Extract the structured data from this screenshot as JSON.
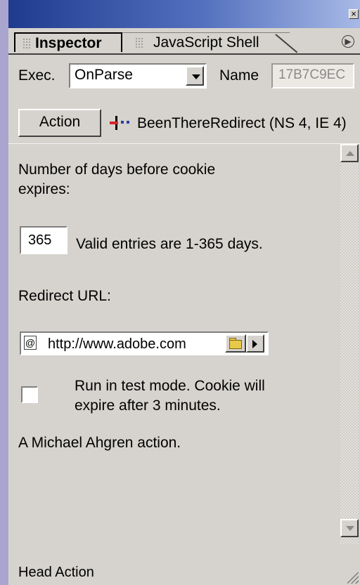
{
  "tabs": {
    "inspector": "Inspector",
    "javascript_shell": "JavaScript Shell"
  },
  "top_row": {
    "exec_label": "Exec.",
    "exec_value": "OnParse",
    "name_label": "Name",
    "name_value": "17B7C9EC"
  },
  "action_row": {
    "button_label": "Action",
    "behavior_name": "BeenThereRedirect (NS 4, IE 4)"
  },
  "content": {
    "days_label": "Number of days before cookie expires:",
    "days_value": "365",
    "days_hint": "Valid entries are 1-365 days.",
    "redirect_label": "Redirect URL:",
    "redirect_url": "http://www.adobe.com",
    "test_mode_label": "Run in test mode. Cookie will expire after 3 minutes.",
    "test_mode_checked": false,
    "author": "A Michael Ahgren action."
  },
  "footer": {
    "status": "Head Action"
  },
  "colors": {
    "panel_bg": "#d6d3ce",
    "title_gradient_start": "#1f3b8e",
    "outer_bg": "#b9b6d8"
  },
  "icons": [
    "close-icon",
    "tab-scroll-arrow-icon",
    "dropdown-arrow-icon",
    "behavior-icon",
    "url-type-icon",
    "folder-icon",
    "point-and-shoot-arrow-icon",
    "scroll-up-icon",
    "scroll-down-icon",
    "resize-grip-icon"
  ]
}
